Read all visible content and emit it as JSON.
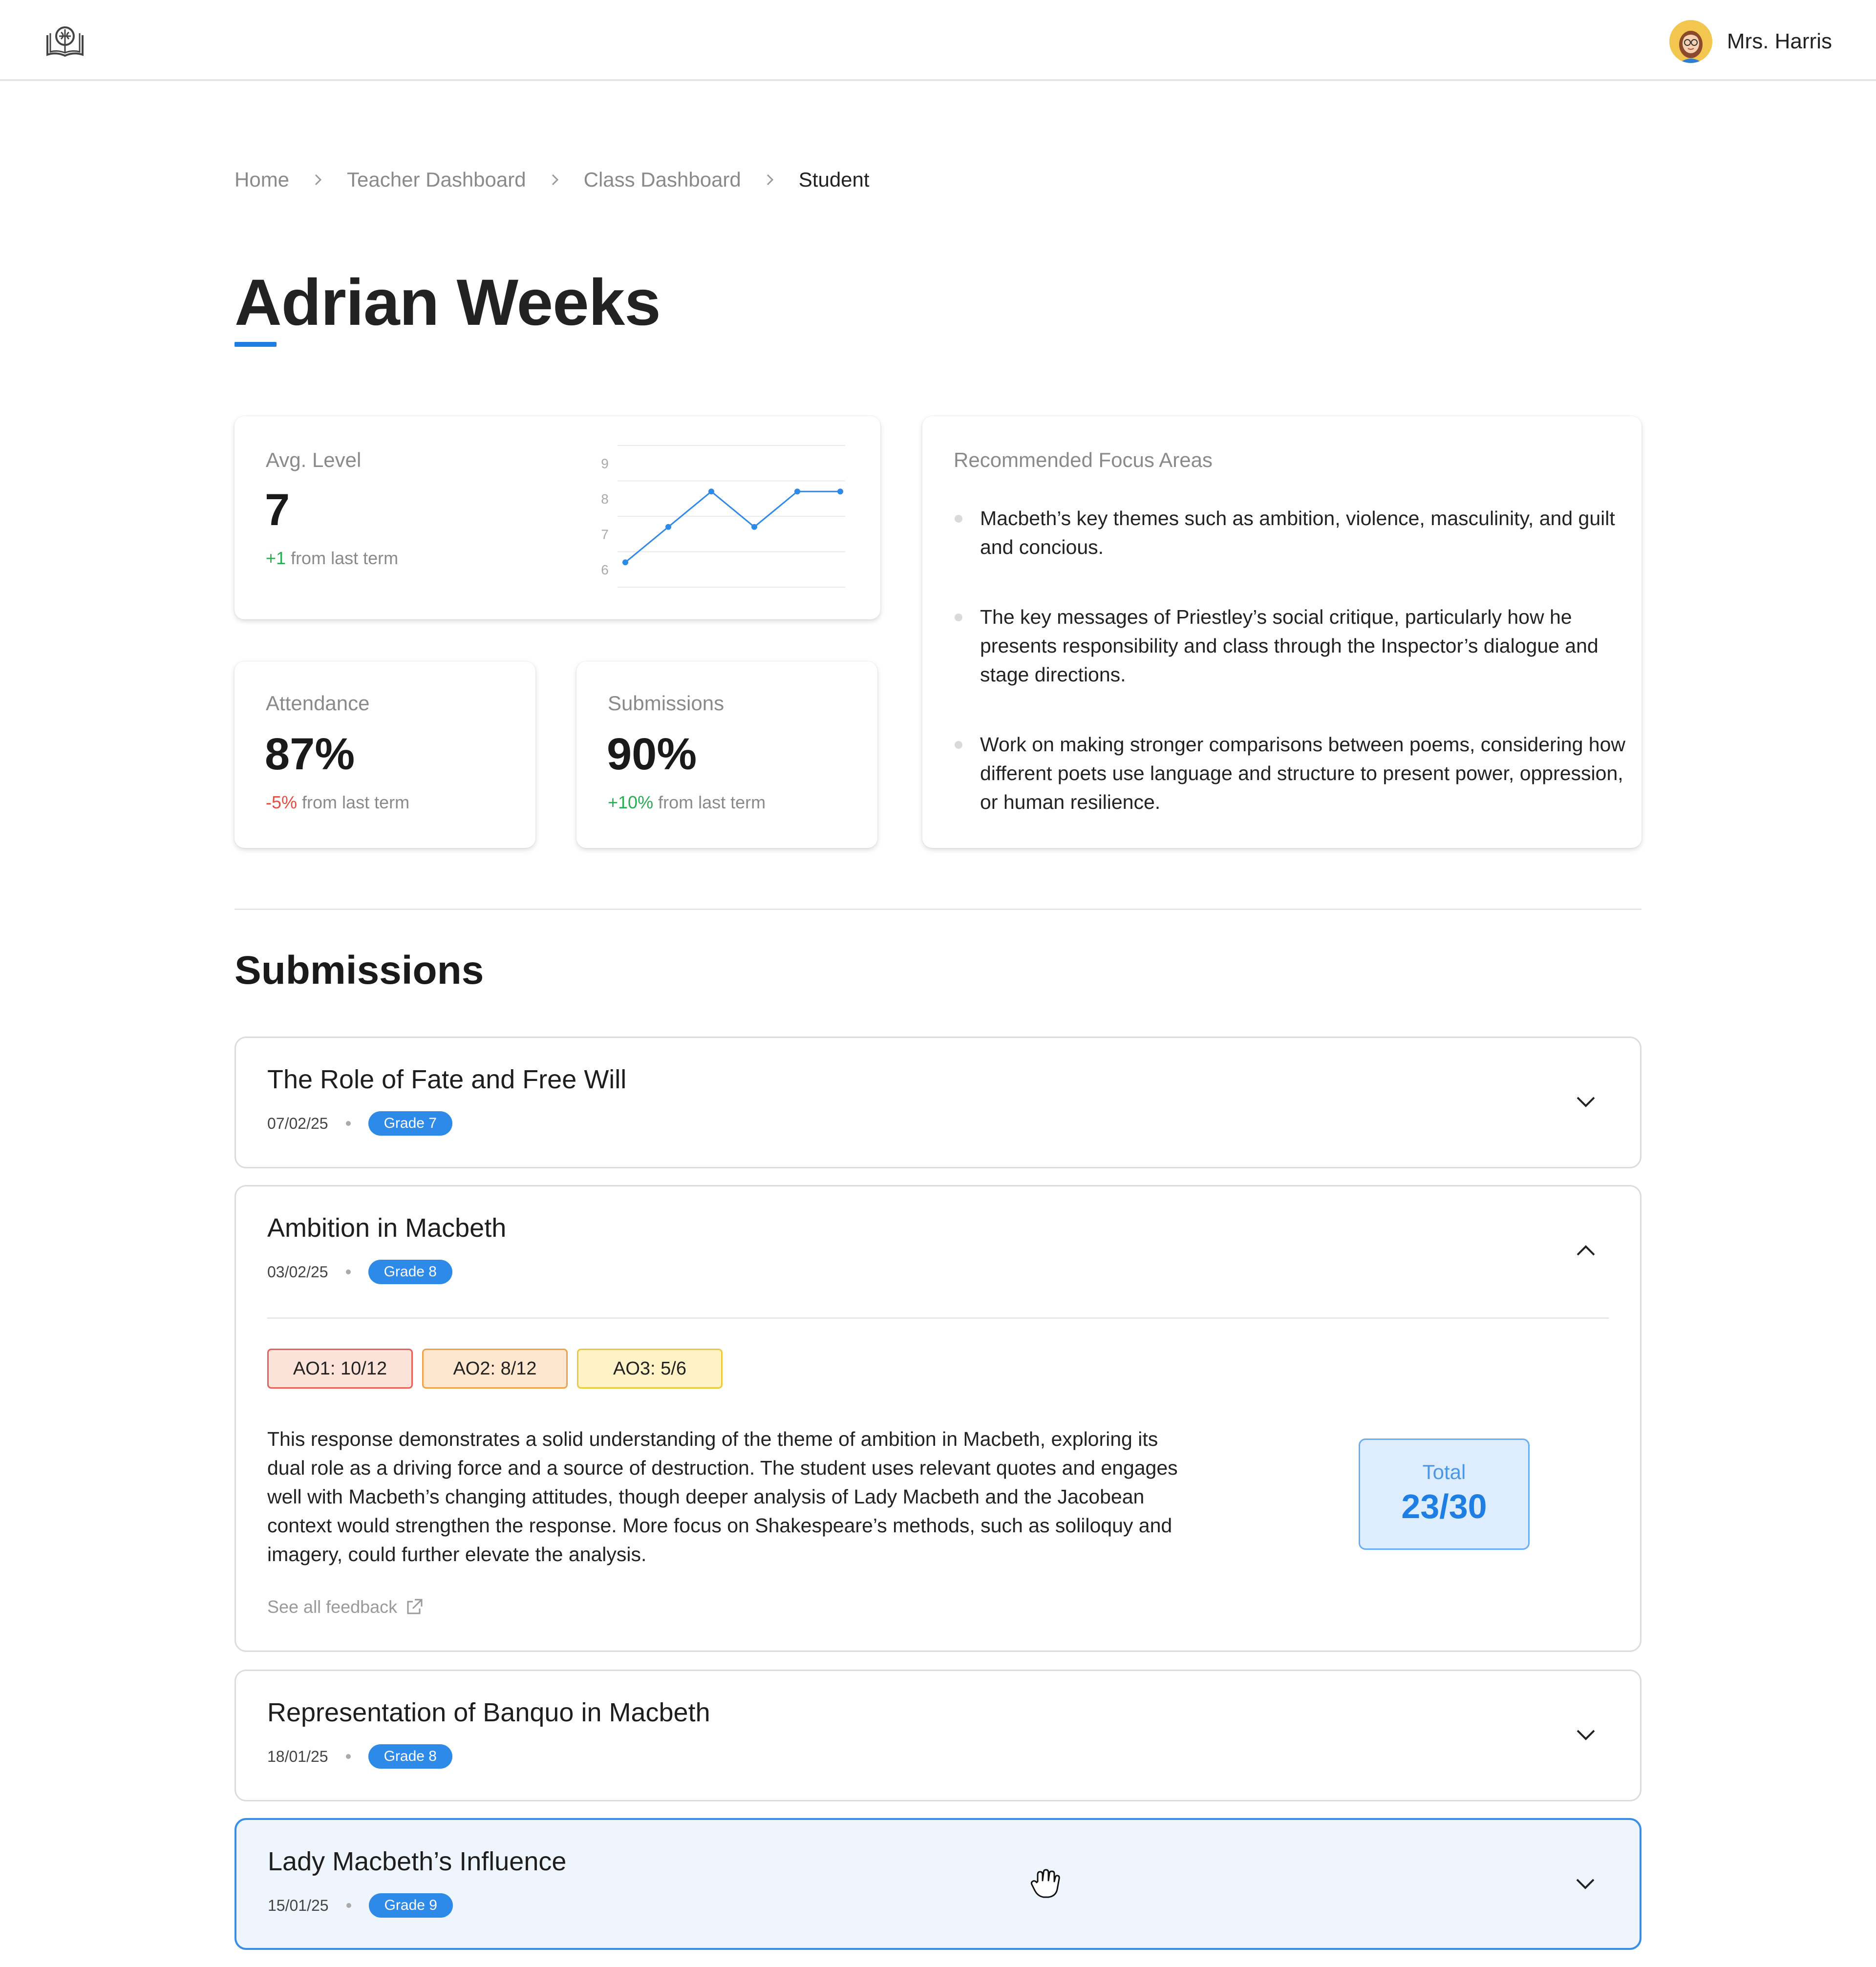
{
  "header": {
    "logo_icon": "book-brain-logo-icon",
    "user_name": "Mrs. Harris",
    "avatar_icon": "teacher-avatar"
  },
  "breadcrumb": {
    "items": [
      "Home",
      "Teacher Dashboard",
      "Class Dashboard"
    ],
    "current": "Student"
  },
  "student": {
    "name": "Adrian Weeks"
  },
  "stats": {
    "avg_level": {
      "label": "Avg. Level",
      "value": "7",
      "delta": "+1",
      "delta_suffix": "from last term"
    },
    "attendance": {
      "label": "Attendance",
      "value": "87%",
      "delta": "-5%",
      "delta_suffix": "from last term"
    },
    "submissions": {
      "label": "Submissions",
      "value": "90%",
      "delta": "+10%",
      "delta_suffix": "from last term"
    }
  },
  "chart_data": {
    "type": "line",
    "y_ticks": [
      "9",
      "8",
      "7",
      "6"
    ],
    "ylim": [
      5.5,
      9.5
    ],
    "x": [
      1,
      2,
      3,
      4,
      5,
      6
    ],
    "series": [
      {
        "values": [
          6.2,
          7.2,
          8.2,
          7.2,
          8.2,
          8.2
        ]
      }
    ],
    "grid": true,
    "color": "#2d8ae8"
  },
  "focus": {
    "title": "Recommended Focus Areas",
    "items": [
      "Macbeth’s key themes such as ambition, violence, masculinity, and guilt and concious.",
      "The key messages of Priestley’s social critique, particularly how he presents responsibility and class through the Inspector’s dialogue and stage directions.",
      "Work on making stronger comparisons between poems, considering how different poets use language and structure to present power, oppression, or human resilience."
    ]
  },
  "submissions_section": {
    "title": "Submissions",
    "items": [
      {
        "title": "The Role of Fate and Free Will",
        "date": "07/02/25",
        "grade": "Grade 7",
        "expanded": false
      },
      {
        "title": "Ambition in Macbeth",
        "date": "03/02/25",
        "grade": "Grade 8",
        "expanded": true,
        "ao": [
          "AO1: 10/12",
          "AO2: 8/12",
          "AO3: 5/6"
        ],
        "feedback": "This response demonstrates a solid understanding of the theme of ambition in Macbeth, exploring its dual role as a driving force and a source of destruction. The student uses relevant quotes and engages well with Macbeth’s changing attitudes, though deeper analysis of Lady Macbeth and the Jacobean context would strengthen the response. More focus on Shakespeare’s methods, such as soliloquy and imagery, could further elevate the analysis.",
        "see_all": "See all feedback",
        "total_label": "Total",
        "total_value": "23/30"
      },
      {
        "title": "Representation of Banquo in Macbeth",
        "date": "18/01/25",
        "grade": "Grade 8",
        "expanded": false
      },
      {
        "title": "Lady Macbeth’s Influence",
        "date": "15/01/25",
        "grade": "Grade 9",
        "expanded": false,
        "hovered": true
      }
    ]
  },
  "colors": {
    "accent": "#2d8ae8",
    "positive": "#2bab54",
    "negative": "#e84c3d"
  }
}
